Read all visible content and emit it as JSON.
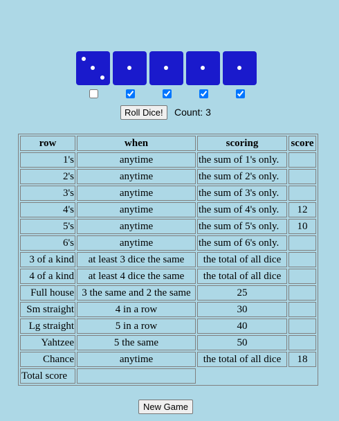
{
  "dice": [
    {
      "value": 3,
      "held": false
    },
    {
      "value": 1,
      "held": true
    },
    {
      "value": 1,
      "held": true
    },
    {
      "value": 1,
      "held": true
    },
    {
      "value": 1,
      "held": true
    }
  ],
  "controls": {
    "roll_label": "Roll Dice!",
    "count_label": "Count:",
    "count_value": "3",
    "new_game_label": "New Game"
  },
  "table": {
    "headers": [
      "row",
      "when",
      "scoring",
      "score"
    ],
    "rows": [
      {
        "row": "1's",
        "when": "anytime",
        "scoring": "the sum of 1's only.",
        "score": ""
      },
      {
        "row": "2's",
        "when": "anytime",
        "scoring": "the sum of 2's only.",
        "score": ""
      },
      {
        "row": "3's",
        "when": "anytime",
        "scoring": "the sum of 3's only.",
        "score": ""
      },
      {
        "row": "4's",
        "when": "anytime",
        "scoring": "the sum of 4's only.",
        "score": "12"
      },
      {
        "row": "5's",
        "when": "anytime",
        "scoring": "the sum of 5's only.",
        "score": "10"
      },
      {
        "row": "6's",
        "when": "anytime",
        "scoring": "the sum of 6's only.",
        "score": ""
      },
      {
        "row": "3 of a kind",
        "when": "at least 3 dice the same",
        "scoring": "the total of all dice",
        "score": ""
      },
      {
        "row": "4 of a kind",
        "when": "at least 4 dice the same",
        "scoring": "the total of all dice",
        "score": ""
      },
      {
        "row": "Full house",
        "when": "3 the same and 2 the same",
        "scoring": "25",
        "score": ""
      },
      {
        "row": "Sm straight",
        "when": "4 in a row",
        "scoring": "30",
        "score": ""
      },
      {
        "row": "Lg straight",
        "when": "5 in a row",
        "scoring": "40",
        "score": ""
      },
      {
        "row": "Yahtzee",
        "when": "5 the same",
        "scoring": "50",
        "score": ""
      },
      {
        "row": "Chance",
        "when": "anytime",
        "scoring": "the total of all dice",
        "score": "18"
      }
    ],
    "total_label": "Total score",
    "total_value": ""
  }
}
